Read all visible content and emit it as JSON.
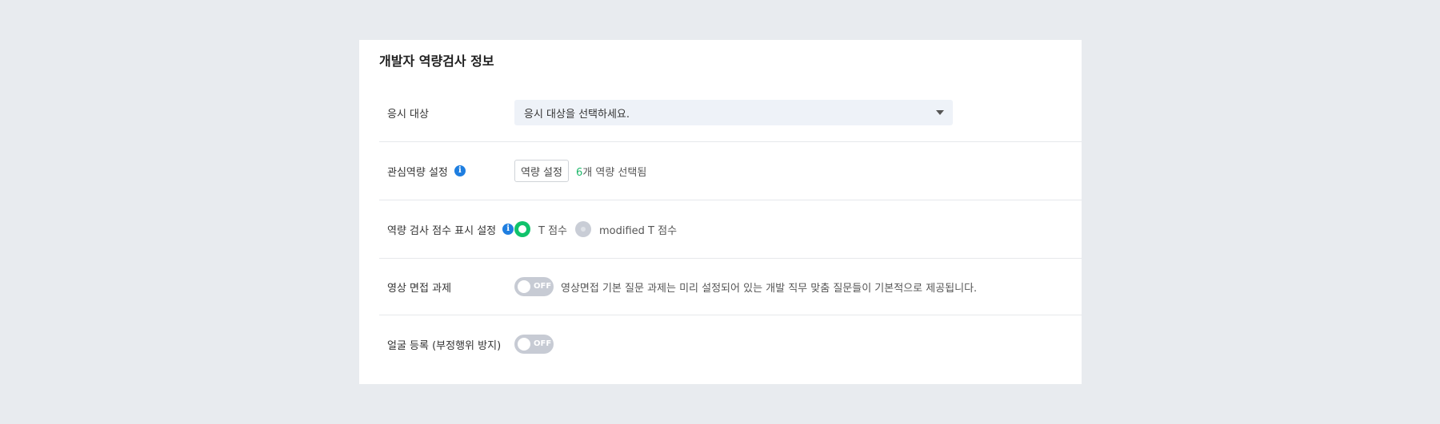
{
  "section": {
    "title": "개발자 역량검사 정보"
  },
  "rows": {
    "target": {
      "label": "응시 대상",
      "select_value": "응시 대상을 선택하세요."
    },
    "competency": {
      "label": "관심역량 설정",
      "info_icon": "i",
      "button_label": "역량 설정",
      "count": "6",
      "count_suffix": "개 역량 선택됨"
    },
    "score_display": {
      "label": "역량 검사 점수 표시 설정",
      "info_icon": "i",
      "options": [
        {
          "label": "T 점수",
          "selected": true
        },
        {
          "label": "modified T 점수",
          "selected": false
        }
      ]
    },
    "video_interview": {
      "label": "영상 면접 과제",
      "toggle_text": "OFF",
      "toggle_on": false,
      "description": "영상면접 기본 질문 과제는 미리 설정되어 있는 개발 직무 맞춤 질문들이 기본적으로 제공됩니다."
    },
    "face_registration": {
      "label": "얼굴 등록 (부정행위 방지)",
      "toggle_text": "OFF",
      "toggle_on": false
    }
  },
  "colors": {
    "page_bg": "#e8ebef",
    "accent_green": "#10c26b",
    "info_blue": "#1e7ee0",
    "toggle_off": "#c7cbd4",
    "select_bg": "#eef2f8"
  }
}
